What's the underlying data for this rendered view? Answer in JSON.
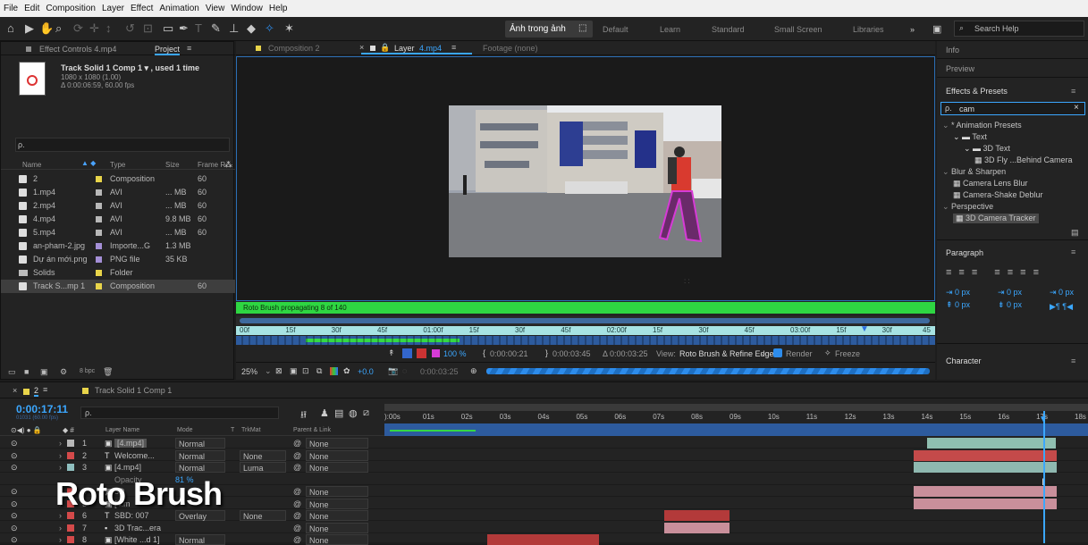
{
  "menu": [
    "File",
    "Edit",
    "Composition",
    "Layer",
    "Effect",
    "Animation",
    "View",
    "Window",
    "Help"
  ],
  "workspaces": {
    "active": "Ảnh trong ảnh",
    "items": [
      "Default",
      "Learn",
      "Standard",
      "Small Screen",
      "Libraries"
    ],
    "more": "»",
    "search_placeholder": "Search Help"
  },
  "project": {
    "tab_effect": "Effect Controls 4.mp4",
    "tab_project": "Project",
    "comp_name": "Track Solid 1 Comp 1 ▾ , used 1 time",
    "comp_size": "1080 x 1080 (1.00)",
    "comp_duration": "Δ 0:00:06:59, 60.00 fps",
    "search_icon": "ρ.",
    "cols": {
      "name": "Name",
      "type": "Type",
      "size": "Size",
      "frame": "Frame R..."
    },
    "rows": [
      {
        "name": "2",
        "type": "Composition",
        "size": "",
        "frame": "60",
        "color": "#e8d44a"
      },
      {
        "name": "1.mp4",
        "type": "AVI",
        "size": "... MB",
        "frame": "60",
        "color": "#b8b8b8"
      },
      {
        "name": "2.mp4",
        "type": "AVI",
        "size": "... MB",
        "frame": "60",
        "color": "#b8b8b8"
      },
      {
        "name": "4.mp4",
        "type": "AVI",
        "size": "9.8 MB",
        "frame": "60",
        "color": "#b8b8b8"
      },
      {
        "name": "5.mp4",
        "type": "AVI",
        "size": "... MB",
        "frame": "60",
        "color": "#b8b8b8"
      },
      {
        "name": "an-pham-2.jpg",
        "type": "Importe...G",
        "size": "1.3 MB",
        "frame": "",
        "color": "#a48fd6"
      },
      {
        "name": "Dự án mới.png",
        "type": "PNG file",
        "size": "35 KB",
        "frame": "",
        "color": "#a48fd6"
      },
      {
        "name": "Solids",
        "type": "Folder",
        "size": "",
        "frame": "",
        "color": "#e8d44a"
      },
      {
        "name": "Track S...mp 1",
        "type": "Composition",
        "size": "",
        "frame": "60",
        "color": "#e8d44a"
      }
    ],
    "bpc": "8 bpc"
  },
  "viewer": {
    "tab_comp": "Composition 2",
    "tab_layer": "Layer",
    "tab_layer_name": "4.mp4",
    "tab_footage": "Footage (none)",
    "status": "Roto Brush propagating 8 of 140",
    "ruler": [
      "00f",
      "15f",
      "30f",
      "45f",
      "01:00f",
      "15f",
      "30f",
      "45f",
      "02:00f",
      "15f",
      "30f",
      "45f",
      "03:00f",
      "15f",
      "30f",
      "45"
    ],
    "zoom_pct": "100 %",
    "t_in": "0:00:00:21",
    "t_out": "0:00:03:45",
    "t_dur": "Δ 0:00:03:25",
    "view_label": "View:",
    "view_value": "Roto Brush & Refine Edge",
    "render_label": "Render",
    "freeze_label": "Freeze",
    "mag": "25%",
    "exposure": "+0.0",
    "time": "0:00:03:25"
  },
  "right": {
    "info": "Info",
    "preview": "Preview",
    "effects": "Effects & Presets",
    "search_value": "cam",
    "tree": [
      {
        "label": "* Animation Presets",
        "indent": 0
      },
      {
        "label": "Text",
        "indent": 1
      },
      {
        "label": "3D Text",
        "indent": 2
      },
      {
        "label": "3D Fly ...Behind Camera",
        "indent": 3
      },
      {
        "label": "Blur & Sharpen",
        "indent": 0
      },
      {
        "label": "Camera Lens Blur",
        "indent": 1
      },
      {
        "label": "Camera-Shake Deblur",
        "indent": 1
      },
      {
        "label": "Perspective",
        "indent": 0
      },
      {
        "label": "3D Camera Tracker",
        "indent": 1
      }
    ],
    "paragraph": "Paragraph",
    "px": "0 px",
    "character": "Character"
  },
  "timeline": {
    "tab1": "2",
    "tab2": "Track Solid 1 Comp 1",
    "timecode": "0:00:17:11",
    "timecode_sub": "01031 (60.00 fps)",
    "cols": {
      "layer": "Layer Name",
      "mode": "Mode",
      "t": "T",
      "trkmat": "TrkMat",
      "parent": "Parent & Link"
    },
    "ruler": [
      "):00s",
      "01s",
      "02s",
      "03s",
      "04s",
      "05s",
      "06s",
      "07s",
      "08s",
      "09s",
      "10s",
      "11s",
      "12s",
      "13s",
      "14s",
      "15s",
      "16s",
      "17s",
      "18s"
    ],
    "layers": [
      {
        "num": "1",
        "name": "[4.mp4]",
        "mode": "Normal",
        "trkmat": "",
        "parent": "None",
        "color": "#b8b8b8"
      },
      {
        "num": "2",
        "name": "Welcome...",
        "mode": "Normal",
        "trkmat": "None",
        "parent": "None",
        "color": "#d44a4a"
      },
      {
        "num": "3",
        "name": "[4.mp4]",
        "mode": "Normal",
        "trkmat": "Luma",
        "parent": "None",
        "color": "#8fbfbf"
      },
      {
        "num": "",
        "name": "Opacity",
        "mode": "81 %",
        "trkmat": "",
        "parent": "",
        "color": ""
      },
      {
        "num": "4",
        "name": "3D",
        "mode": "",
        "trkmat": "",
        "parent": "None",
        "color": "#d44a4a"
      },
      {
        "num": "5",
        "name": "[4.m",
        "mode": "",
        "trkmat": "",
        "parent": "None",
        "color": "#d44a4a"
      },
      {
        "num": "6",
        "name": "SBD: 007",
        "mode": "Overlay",
        "trkmat": "None",
        "parent": "None",
        "color": "#d44a4a"
      },
      {
        "num": "7",
        "name": "3D Trac...era",
        "mode": "",
        "trkmat": "",
        "parent": "None",
        "color": "#d44a4a"
      },
      {
        "num": "8",
        "name": "[White ...d 1]",
        "mode": "Normal",
        "trkmat": "",
        "parent": "None",
        "color": "#d44a4a"
      }
    ],
    "overlay_text": "Roto Brush"
  }
}
